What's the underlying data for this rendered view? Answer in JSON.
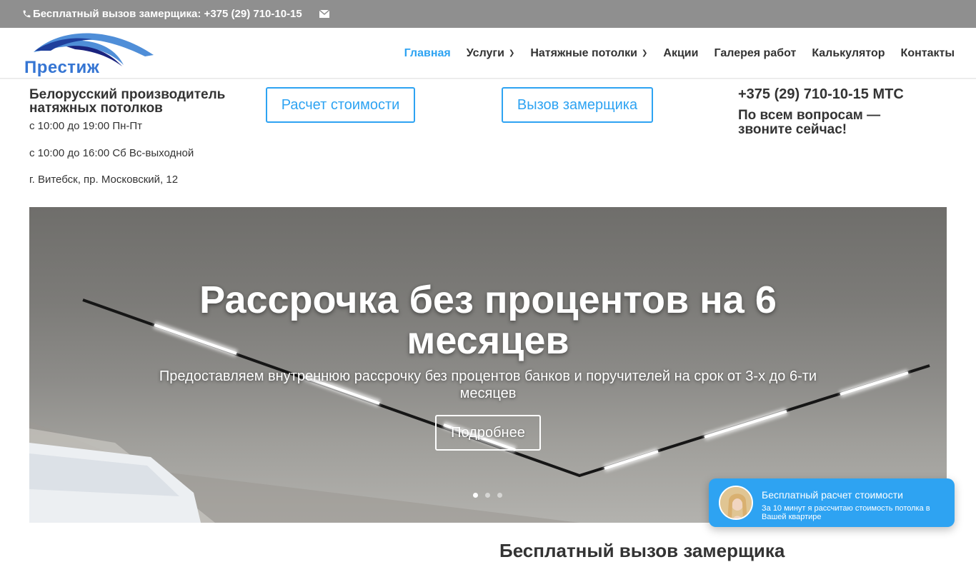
{
  "topbar": {
    "phone_text": "Бесплатный вызов замерщика: +375 (29) 710-10-15",
    "phone_icon": "phone-icon",
    "mail_icon": "mail-icon"
  },
  "header": {
    "logo_text": "Престиж",
    "nav": [
      {
        "label": "Главная",
        "active": true,
        "dropdown": false
      },
      {
        "label": "Услуги",
        "active": false,
        "dropdown": true
      },
      {
        "label": "Натяжные потолки",
        "active": false,
        "dropdown": true
      },
      {
        "label": "Акции",
        "active": false,
        "dropdown": false
      },
      {
        "label": "Галерея работ",
        "active": false,
        "dropdown": false
      },
      {
        "label": "Калькулятор",
        "active": false,
        "dropdown": false
      },
      {
        "label": "Контакты",
        "active": false,
        "dropdown": false
      }
    ],
    "accent_color": "#2ea3f2"
  },
  "info": {
    "tagline": "Белорусский производитель натяжных потолков",
    "hours1": "с 10:00  до 19:00 Пн-Пт",
    "hours2": "с 10:00  до 16:00   Сб     Вс-выходной",
    "address": "г. Витебск, пр. Московский, 12",
    "calc_button": "Расчет стоимости",
    "measure_button": "Вызов замерщика",
    "phone": "+375 (29) 710-10-15 МТС",
    "call_now": "По всем вопросам — звоните сейчас!"
  },
  "hero": {
    "title": "Рассрочка без процентов на 6 месяцев",
    "subtitle": "Предоставляем внутреннюю рассрочку без процентов банков и поручителей на срок от 3-х до 6-ти месяцев",
    "button": "Подробнее",
    "slides_total": 3,
    "active_slide": 1
  },
  "bottom": {
    "heading": "Бесплатный вызов замерщика"
  },
  "chat": {
    "title": "Бесплатный расчет стоимости",
    "subtitle": "За 10 минут я рассчитаю стоимость потолка в Вашей квартире"
  }
}
